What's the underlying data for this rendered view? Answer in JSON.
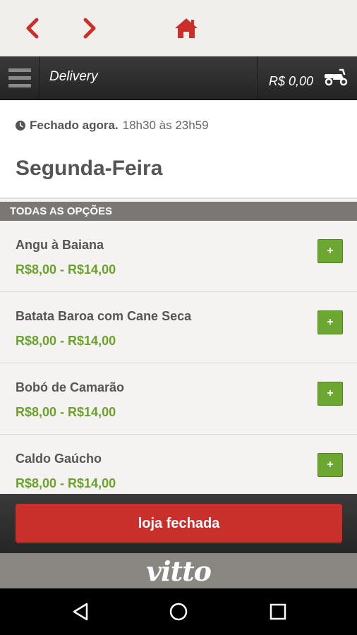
{
  "nav": {
    "back_icon": "chevron-left-icon",
    "forward_icon": "chevron-right-icon",
    "home_icon": "home-icon",
    "accent_color": "#c9302c"
  },
  "header": {
    "title": "Delivery",
    "cart_amount": "R$ 0,00",
    "cart_icon": "scooter-icon"
  },
  "status": {
    "state": "Fechado agora.",
    "hours": "18h30 às 23h59",
    "day": "Segunda-Feira"
  },
  "section": {
    "title": "TODAS AS OPÇÕES"
  },
  "items": [
    {
      "name": "Angu à Baiana",
      "price": "R$8,00 - R$14,00",
      "add_label": "+"
    },
    {
      "name": "Batata Baroa com Cane Seca",
      "price": "R$8,00 - R$14,00",
      "add_label": "+"
    },
    {
      "name": "Bobó de Camarão",
      "price": "R$8,00 - R$14,00",
      "add_label": "+"
    },
    {
      "name": "Caldo Gaúcho",
      "price": "R$8,00 - R$14,00",
      "add_label": "+"
    }
  ],
  "footer": {
    "button_label": "loja fechada",
    "brand": "vitto"
  },
  "colors": {
    "price_green": "#6aa22a",
    "button_red": "#c9302c"
  }
}
